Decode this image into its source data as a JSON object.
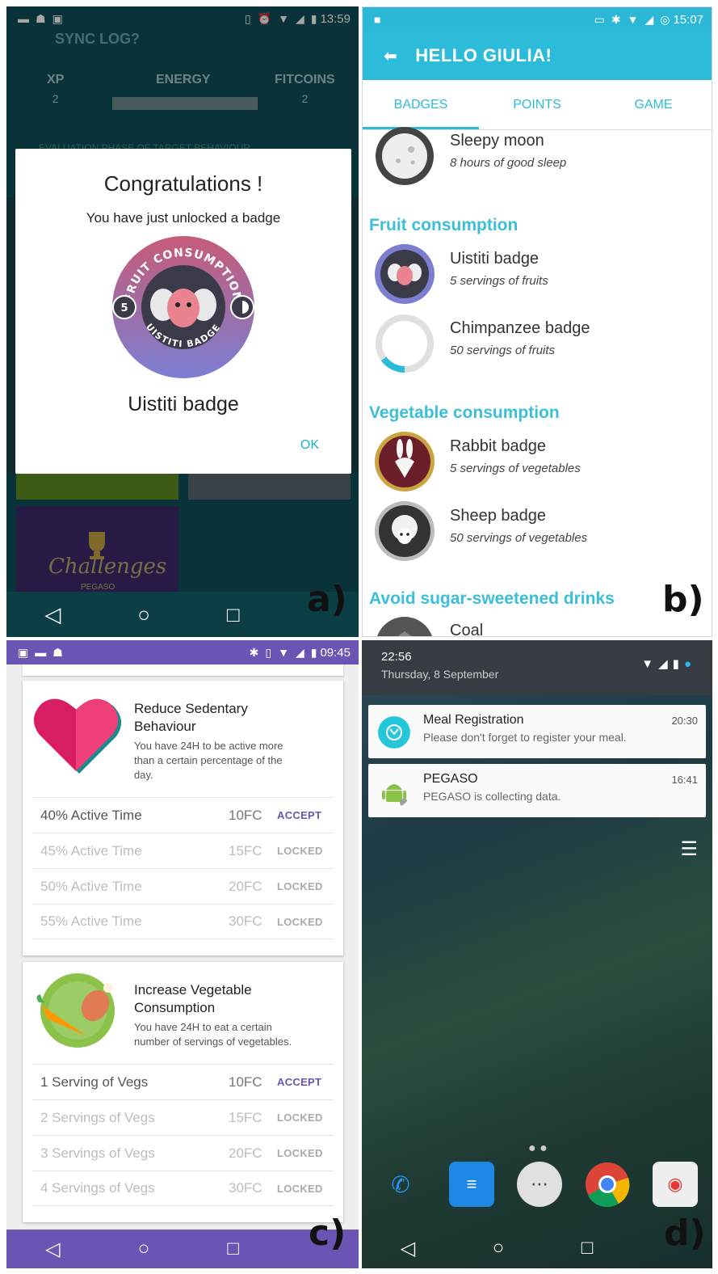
{
  "labels": {
    "a": "a)",
    "b": "b)",
    "c": "c)",
    "d": "d)"
  },
  "panel_a": {
    "status": {
      "time": "13:59"
    },
    "app_name": "SYNC LOG?",
    "stats": {
      "xp_label": "XP",
      "xp_value": "2",
      "energy_label": "ENERGY",
      "fitcoins_label": "FITCOINS",
      "fitcoins_value": "2"
    },
    "phase_text": "EVALUATION PHASE OF TARGET BEHAVIOUR",
    "dialog": {
      "title": "Congratulations !",
      "subtitle": "You have just unlocked a badge",
      "badge_top_text": "FRUIT CONSUMPTION",
      "badge_bottom_text": "UISTITI BADGE",
      "badge_number": "5",
      "badge_name": "Uistiti badge",
      "ok_label": "OK"
    },
    "challenge_tile": {
      "title": "Challenges",
      "brand": "PEGASO"
    }
  },
  "panel_b": {
    "status": {
      "time": "15:07"
    },
    "header": "HELLO GIULIA!",
    "tabs": [
      {
        "label": "BADGES",
        "active": true
      },
      {
        "label": "POINTS",
        "active": false
      },
      {
        "label": "GAME",
        "active": false
      }
    ],
    "items": [
      {
        "name": "Sleepy moon",
        "desc": "8 hours of good sleep"
      },
      {
        "section": "Fruit consumption"
      },
      {
        "name": "Uistiti badge",
        "desc": "5 servings of fruits"
      },
      {
        "name": "Chimpanzee badge",
        "desc": "50 servings of fruits",
        "progress": 0.15
      },
      {
        "section": "Vegetable consumption"
      },
      {
        "name": "Rabbit badge",
        "desc": "5 servings of vegetables"
      },
      {
        "name": "Sheep badge",
        "desc": "50 servings of vegetables"
      },
      {
        "section": "Avoid sugar-sweetened drinks"
      },
      {
        "name": "Coal",
        "desc": ""
      }
    ],
    "colors": {
      "accent": "#2cbcd9"
    }
  },
  "panel_c": {
    "status": {
      "time": "09:45"
    },
    "cards": [
      {
        "title": "Reduce Sedentary Behaviour",
        "title_lines": [
          "Reduce Sedentary",
          "Behaviour"
        ],
        "desc_lines": [
          "You have 24H to be active more",
          "than a certain percentage of the",
          "day."
        ],
        "rows": [
          {
            "label": "40% Active Time",
            "fc": "10FC",
            "action": "ACCEPT"
          },
          {
            "label": "45% Active Time",
            "fc": "15FC",
            "action": "LOCKED"
          },
          {
            "label": "50% Active Time",
            "fc": "20FC",
            "action": "LOCKED"
          },
          {
            "label": "55% Active Time",
            "fc": "30FC",
            "action": "LOCKED"
          }
        ]
      },
      {
        "title_lines": [
          "Increase Vegetable",
          "Consumption"
        ],
        "desc_lines": [
          "You have 24H to eat a certain",
          "number of servings of vegetables."
        ],
        "rows": [
          {
            "label": "1 Serving of Vegs",
            "fc": "10FC",
            "action": "ACCEPT"
          },
          {
            "label": "2 Servings of Vegs",
            "fc": "15FC",
            "action": "LOCKED"
          },
          {
            "label": "3 Servings of Vegs",
            "fc": "20FC",
            "action": "LOCKED"
          },
          {
            "label": "4 Servings of Vegs",
            "fc": "30FC",
            "action": "LOCKED"
          }
        ]
      }
    ],
    "colors": {
      "accent": "#6a55b5"
    }
  },
  "panel_d": {
    "shade": {
      "time": "22:56",
      "date": "Thursday, 8 September"
    },
    "notifications": [
      {
        "title": "Meal Registration",
        "body": "Please don't forget to register your meal.",
        "time": "20:30",
        "icon": "meal-icon"
      },
      {
        "title": "PEGASO",
        "body": "PEGASO is collecting data.",
        "time": "16:41",
        "icon": "android-icon"
      }
    ]
  }
}
